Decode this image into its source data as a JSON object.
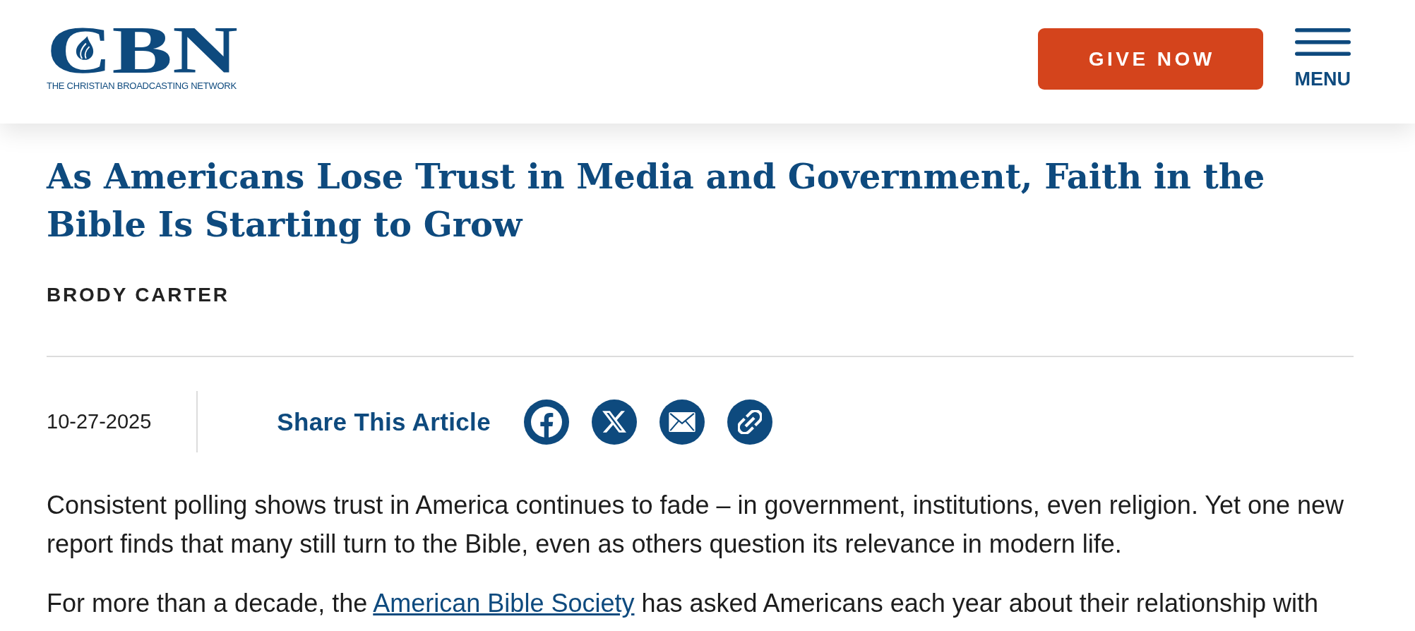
{
  "header": {
    "logo": {
      "wordmark": "CBN",
      "tagline": "THE CHRISTIAN BROADCASTING NETWORK"
    },
    "give_button": "GIVE NOW",
    "menu_button": "MENU"
  },
  "article": {
    "title": "As Americans Lose Trust in Media and Government, Faith in the Bible Is Starting to Grow",
    "author": "BRODY CARTER",
    "date": "10-27-2025",
    "share": {
      "label": "Share This Article",
      "buttons": [
        {
          "kind": "facebook"
        },
        {
          "kind": "x"
        },
        {
          "kind": "email"
        },
        {
          "kind": "link"
        }
      ]
    },
    "paragraphs": [
      {
        "segments": [
          {
            "kind": "text",
            "text": "Consistent polling shows trust in America continues to fade – in government, institutions, even religion. Yet one new report finds that many still turn to the Bible, even as others question its relevance in modern life."
          }
        ]
      },
      {
        "segments": [
          {
            "kind": "text",
            "text": "For more than a decade, the "
          },
          {
            "kind": "link",
            "text": "American Bible Society"
          },
          {
            "kind": "text",
            "text": " has asked Americans each year about their relationship with"
          }
        ]
      }
    ]
  }
}
